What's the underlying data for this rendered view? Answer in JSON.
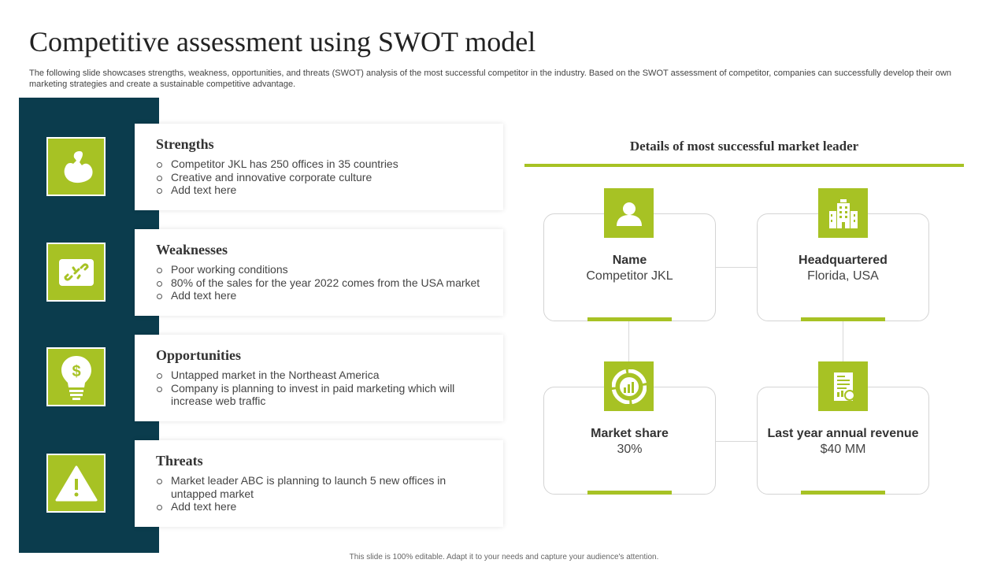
{
  "title": "Competitive assessment using SWOT model",
  "subtitle": "The following slide showcases strengths, weakness, opportunities, and threats (SWOT) analysis of the most successful competitor in the industry. Based on the SWOT assessment of competitor, companies can successfully develop their own marketing strategies and create a sustainable competitive advantage.",
  "swot": [
    {
      "heading": "Strengths",
      "icon": "flexed-arm-icon",
      "items": [
        "Competitor JKL has 250 offices in 35 countries",
        "Creative and innovative corporate culture",
        "Add text here"
      ]
    },
    {
      "heading": "Weaknesses",
      "icon": "broken-link-icon",
      "items": [
        "Poor working conditions",
        "80% of the sales for the year 2022 comes from the USA market",
        "Add text here"
      ]
    },
    {
      "heading": "Opportunities",
      "icon": "dollar-lightbulb-icon",
      "items": [
        "Untapped market in the Northeast America",
        "Company is planning to invest in paid marketing which will increase web traffic"
      ]
    },
    {
      "heading": "Threats",
      "icon": "warning-icon",
      "items": [
        "Market leader ABC is planning to launch 5 new offices in untapped market",
        "Add text here"
      ]
    }
  ],
  "details": {
    "title": "Details of  most successful market leader",
    "cards": [
      {
        "label": "Name",
        "value": "Competitor JKL",
        "icon": "user-icon"
      },
      {
        "label": "Headquartered",
        "value": "Florida, USA",
        "icon": "building-icon"
      },
      {
        "label": "Market share",
        "value": "30%",
        "icon": "pie-chart-icon"
      },
      {
        "label": "Last year annual revenue",
        "value": "$40 MM",
        "icon": "invoice-icon"
      }
    ]
  },
  "footer": "This slide is 100% editable. Adapt it to your needs and capture your audience's attention.",
  "colors": {
    "accent": "#a7c224",
    "band": "#0b3c4d"
  }
}
